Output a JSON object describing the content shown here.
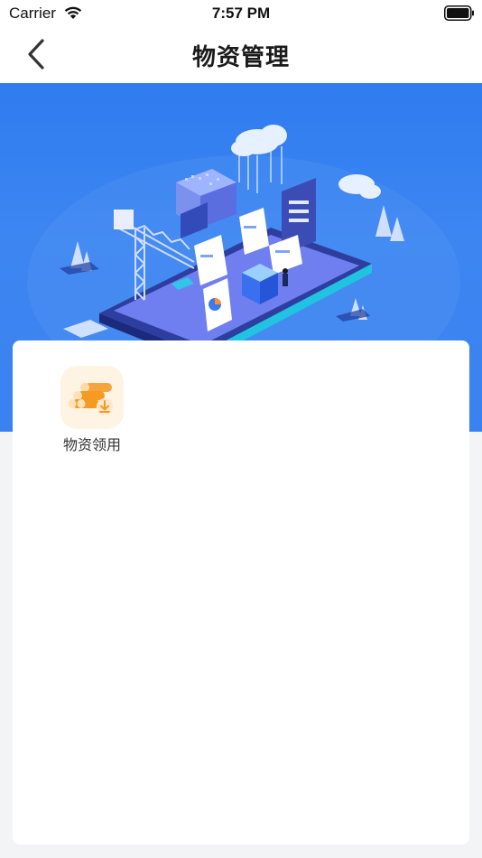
{
  "status_bar": {
    "carrier": "Carrier",
    "time": "7:57 PM",
    "icons": [
      "wifi-icon",
      "battery-icon"
    ]
  },
  "nav": {
    "title": "物资管理",
    "back_icon": "chevron-left-icon"
  },
  "banner": {
    "illustration": "isometric-smart-city-illustration",
    "colors": {
      "top": "#2f7cf0",
      "bottom": "#3a82ef"
    }
  },
  "menu": {
    "items": [
      {
        "label": "物资领用",
        "icon": "materials-pipes-icon"
      }
    ]
  },
  "colors": {
    "accent": "#3a82ef",
    "icon_orange": "#f59a23",
    "icon_bg": "#fff3e4",
    "page_bg": "#f3f4f6"
  }
}
